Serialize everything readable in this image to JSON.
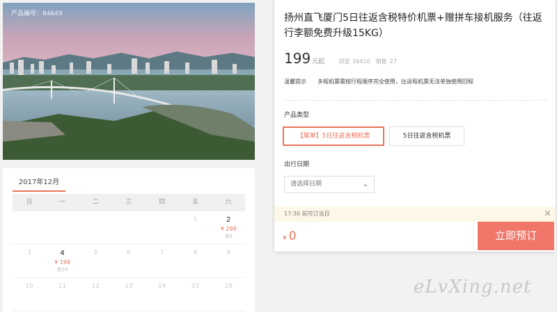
{
  "hero": {
    "product_no": "产品编号：84649",
    "image_alt": "city-bay-bridge-photo"
  },
  "calendar": {
    "month_tab": "2017年12月",
    "weekdays": [
      "日",
      "一",
      "二",
      "三",
      "四",
      "五",
      "六"
    ],
    "rows": [
      [
        {
          "d": ""
        },
        {
          "d": ""
        },
        {
          "d": ""
        },
        {
          "d": ""
        },
        {
          "d": ""
        },
        {
          "d": "1"
        },
        {
          "d": "2",
          "price": "¥ 299",
          "remain": "余5",
          "active": true
        }
      ],
      [
        {
          "d": "3"
        },
        {
          "d": "4",
          "price": "¥ 199",
          "remain": "余10",
          "active": true
        },
        {
          "d": "5"
        },
        {
          "d": "6"
        },
        {
          "d": "7"
        },
        {
          "d": "8"
        },
        {
          "d": "9"
        }
      ],
      [
        {
          "d": "10"
        },
        {
          "d": "11"
        },
        {
          "d": "12"
        },
        {
          "d": "13"
        },
        {
          "d": "14"
        },
        {
          "d": "15"
        },
        {
          "d": "16"
        }
      ]
    ]
  },
  "product": {
    "title": "扬州直飞厦门5日往返含税特价机票+赠拼车接机服务（往返行李额免费升级15KG）",
    "price": "199",
    "price_unit": "元起",
    "views_label": "浏览",
    "views": "16410",
    "sales_label": "销售",
    "sales": "27",
    "notice_label": "温馨提示",
    "notice_text1": "多程机票需按行程顺序完全使用，往返程机票无法单独使用回程",
    "type_label": "产品类型",
    "options": [
      "【尾单】5日往返含税机票",
      "5日往返含税机票"
    ],
    "date_label": "出行日期",
    "date_placeholder": "请选择日期",
    "tip": "17:30 前可订当日",
    "currency": "¥",
    "total": "0",
    "book_label": "立即预订"
  },
  "watermark": "eLvXing.net",
  "colors": {
    "accent": "#e9735b",
    "book_button": "#ef7668",
    "tip_bg": "#fdf7e8"
  }
}
